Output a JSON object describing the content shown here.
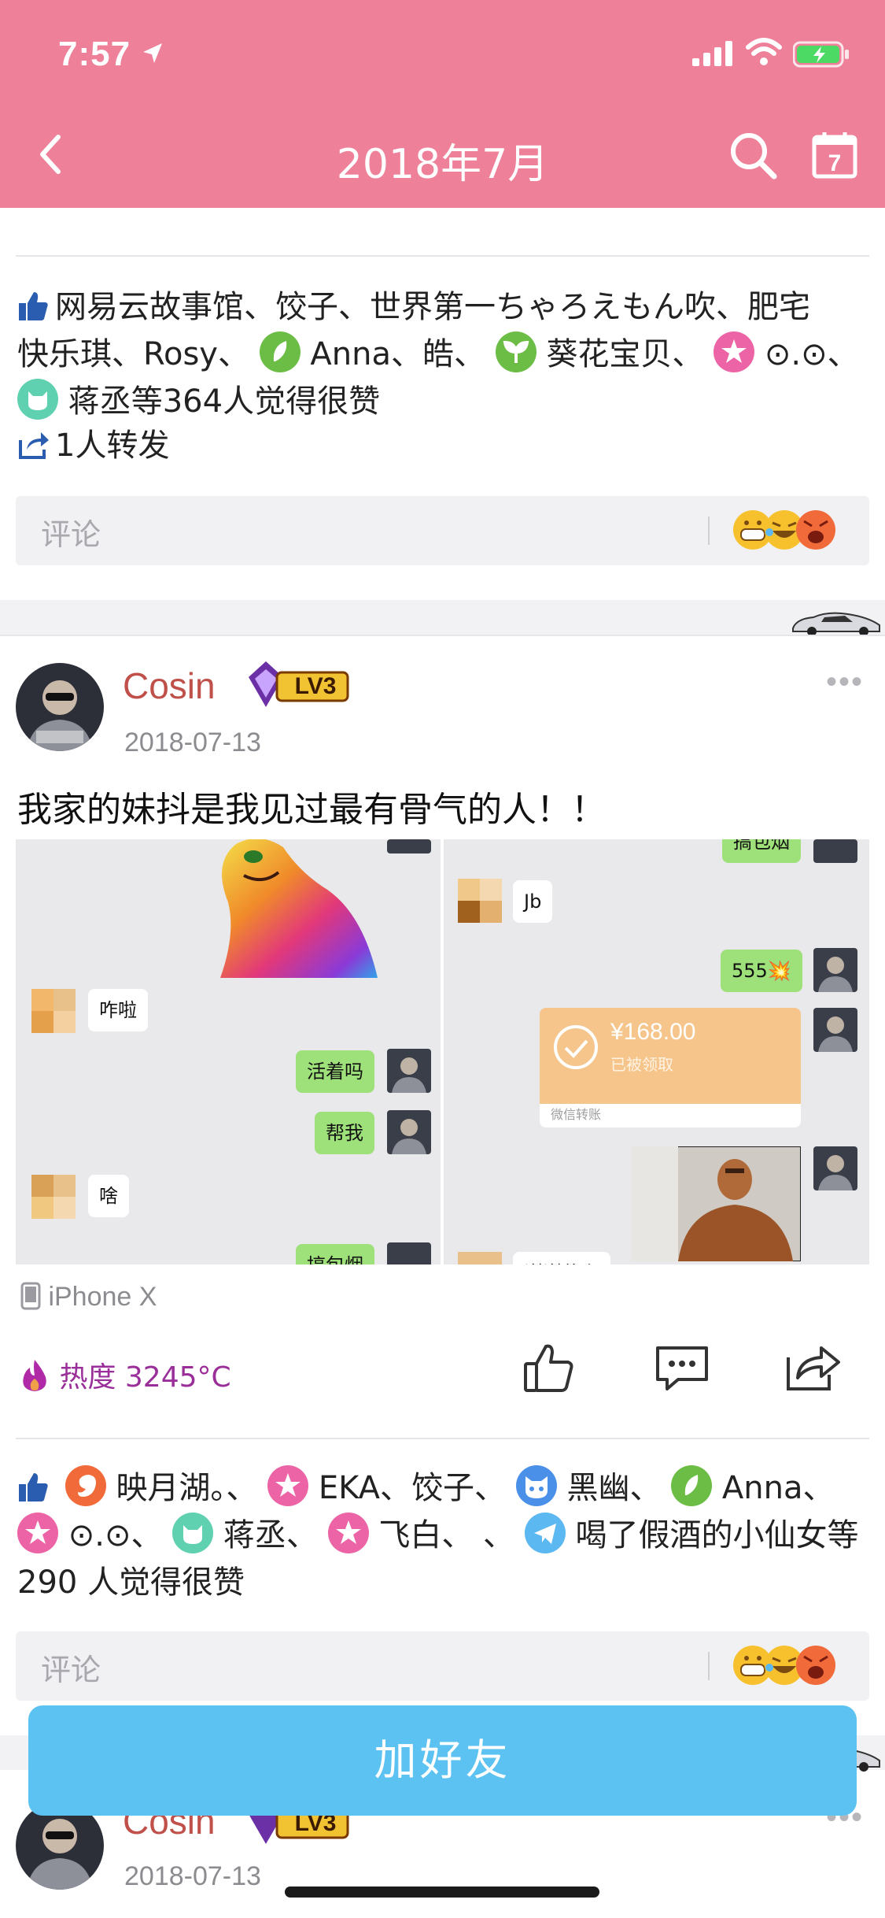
{
  "status_bar": {
    "time": "7:57"
  },
  "nav": {
    "title": "2018年7月"
  },
  "post1": {
    "likes_line1": "网易云故事馆、饺子、世界第一ちゃろえもん吹、肥宅",
    "likes_line2a": "快乐琪、Rosy、",
    "likes_line2b": "Anna、皓、",
    "likes_line2c": "葵花宝贝、",
    "likes_line2d": "⊙.⊙、",
    "likes_line3": "蒋丞等364人觉得很赞",
    "reposts": "1人转发",
    "comment_placeholder": "评论"
  },
  "post2": {
    "username": "Cosin",
    "level_badge": "LV3",
    "date": "2018-07-13",
    "text": "我家的妹抖是我见过最有骨气的人！！",
    "device": "iPhone X",
    "heat": "热度 3245°C",
    "likes_line1a": "映月湖。、",
    "likes_line1b": "EKA、饺子、",
    "likes_line1c": "黑幽、",
    "likes_line1d": "Anna、",
    "likes_line2a": "⊙.⊙、",
    "likes_line2b": "蒋丞、",
    "likes_line2c": "飞白、 、",
    "likes_line2d": "喝了假酒的小仙女等",
    "likes_line3": "290 人觉得很赞",
    "comment_placeholder": "评论",
    "chat_left": {
      "msg_1": "咋啦",
      "msg_2": "活着吗",
      "msg_3": "帮我",
      "msg_4": "啥",
      "msg_5": "搞包烟"
    },
    "chat_right": {
      "msg_1": "搞包烟",
      "msg_2": "Jb",
      "msg_3": "555💥",
      "transfer_amount": "¥168.00",
      "transfer_status": "已被领取",
      "transfer_label": "微信转账",
      "msg_4": "谢谢什么"
    }
  },
  "post3": {
    "username": "Cosin",
    "level_badge": "LV3",
    "date": "2018-07-13"
  },
  "cta": {
    "label": "加好友"
  },
  "colors": {
    "nav_bg": "#ee8099",
    "username": "#c0504a",
    "heat": "#9a2f9a",
    "cta_bg": "#5cc2f2"
  }
}
